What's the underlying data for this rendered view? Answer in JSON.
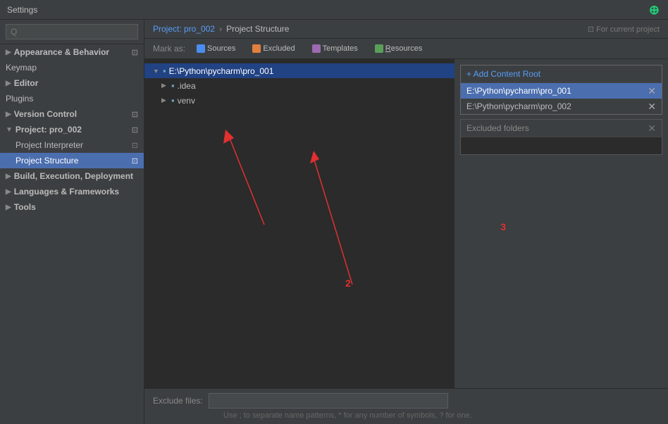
{
  "titleBar": {
    "title": "Settings"
  },
  "sidebar": {
    "search": {
      "placeholder": "Q",
      "value": ""
    },
    "items": [
      {
        "id": "appearance",
        "label": "Appearance & Behavior",
        "indent": 0,
        "hasArrow": true,
        "isGroup": true,
        "icon": ""
      },
      {
        "id": "keymap",
        "label": "Keymap",
        "indent": 0,
        "hasArrow": false,
        "isGroup": false
      },
      {
        "id": "editor",
        "label": "Editor",
        "indent": 0,
        "hasArrow": true,
        "isGroup": true
      },
      {
        "id": "plugins",
        "label": "Plugins",
        "indent": 0,
        "hasArrow": false
      },
      {
        "id": "version-control",
        "label": "Version Control",
        "indent": 0,
        "hasArrow": true,
        "isGroup": true
      },
      {
        "id": "project",
        "label": "Project: pro_002",
        "indent": 0,
        "hasArrow": true,
        "isGroup": true,
        "isOpen": true
      },
      {
        "id": "project-interpreter",
        "label": "Project Interpreter",
        "indent": 1,
        "hasArrow": false
      },
      {
        "id": "project-structure",
        "label": "Project Structure",
        "indent": 1,
        "hasArrow": false,
        "active": true
      },
      {
        "id": "build",
        "label": "Build, Execution, Deployment",
        "indent": 0,
        "hasArrow": true,
        "isGroup": true
      },
      {
        "id": "languages",
        "label": "Languages & Frameworks",
        "indent": 0,
        "hasArrow": true,
        "isGroup": true
      },
      {
        "id": "tools",
        "label": "Tools",
        "indent": 0,
        "hasArrow": true,
        "isGroup": true
      }
    ]
  },
  "breadcrumb": {
    "project": "Project: pro_002",
    "separator": "›",
    "current": "Project Structure",
    "tag": "⊡ For current project"
  },
  "markAs": {
    "label": "Mark as:",
    "buttons": [
      {
        "id": "sources",
        "label": "Sources",
        "color": "blue"
      },
      {
        "id": "excluded",
        "label": "Excluded",
        "color": "orange"
      },
      {
        "id": "templates",
        "label": "Templates",
        "color": "purple"
      },
      {
        "id": "resources",
        "label": "Resources",
        "color": "green"
      }
    ]
  },
  "tree": {
    "items": [
      {
        "id": "root",
        "label": "E:\\Python\\pycharm\\pro_001",
        "indent": 0,
        "arrow": "▼",
        "icon": "📁",
        "selected": true
      },
      {
        "id": "idea",
        "label": ".idea",
        "indent": 1,
        "arrow": "▶",
        "icon": "📁"
      },
      {
        "id": "venv",
        "label": "venv",
        "indent": 1,
        "arrow": "▶",
        "icon": "📁"
      }
    ]
  },
  "rightPanel": {
    "addContentRoot": "+ Add Content Root",
    "contentRoots": [
      {
        "id": "root1",
        "path": "E:\\Python\\pycharm\\pro_001",
        "active": true
      },
      {
        "id": "root2",
        "path": "E:\\Python\\pycharm\\pro_002",
        "active": false
      }
    ],
    "excludedFolders": {
      "label": "Excluded folders",
      "entry": ""
    }
  },
  "bottomBar": {
    "excludeFilesLabel": "Exclude files:",
    "excludeFilesValue": "",
    "hint": "Use ; to separate name patterns, * for any number of symbols, ? for one."
  },
  "annotations": {
    "label2": "2",
    "label3": "3"
  }
}
